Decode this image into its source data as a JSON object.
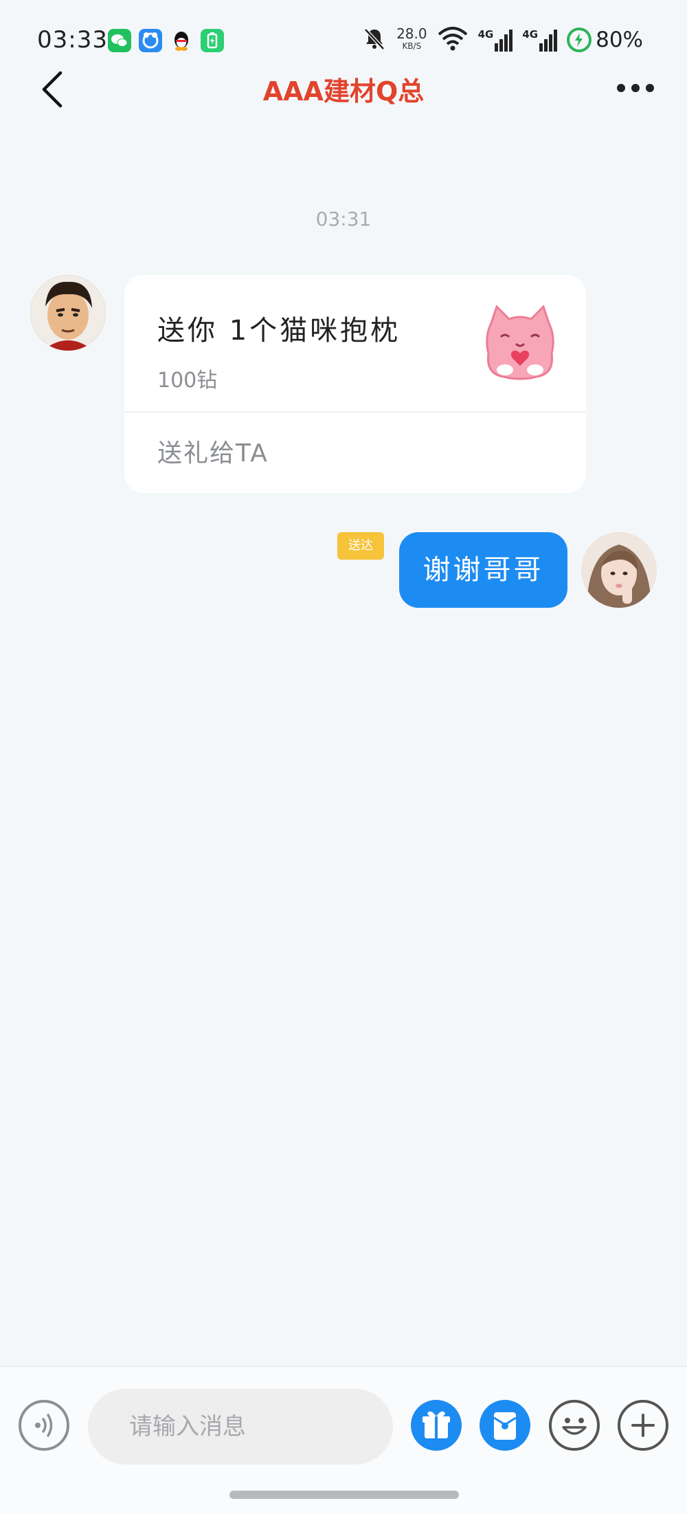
{
  "status_bar": {
    "time": "03:33",
    "net_speed": "28.0",
    "net_speed_unit": "KB/S",
    "signal_1": "4G",
    "signal_2": "4G",
    "battery": "80%",
    "app_icons": [
      "wechat-icon",
      "message-app-icon",
      "qq-icon",
      "battery-saver-icon"
    ]
  },
  "header": {
    "title": "AAA建材Q总"
  },
  "conversation": {
    "timestamp": "03:31",
    "gift_message": {
      "title": "送你 1个猫咪抱枕",
      "price": "100钻",
      "action_label": "送礼给TA"
    },
    "reply_message": {
      "status": "送达",
      "text": "谢谢哥哥"
    }
  },
  "composer": {
    "placeholder": "请输入消息"
  },
  "colors": {
    "accent": "#1d8cf2",
    "title": "#e2432c",
    "badge": "#f6c33a",
    "background": "#f4f7fa"
  }
}
